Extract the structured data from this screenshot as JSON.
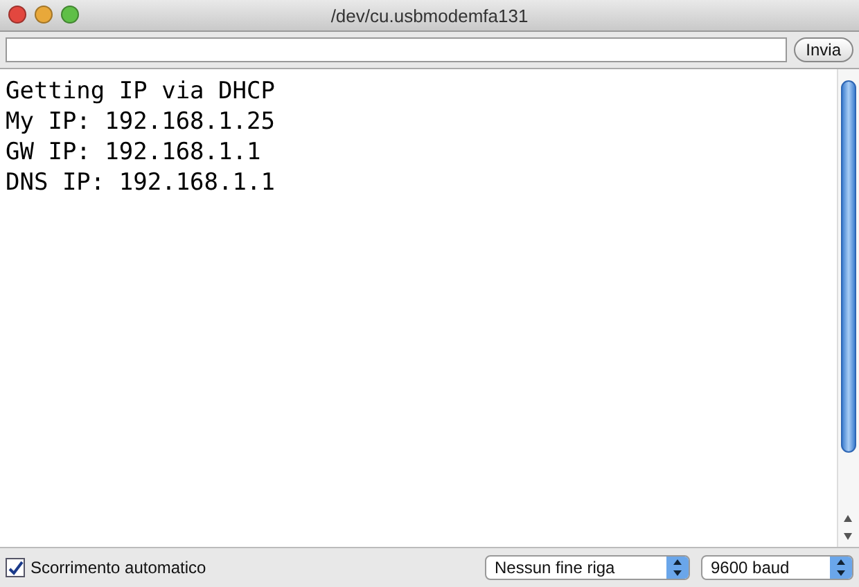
{
  "window": {
    "title": "/dev/cu.usbmodemfa131"
  },
  "send_row": {
    "button": "Invia"
  },
  "output_lines": [
    "Getting IP via DHCP",
    "My IP: 192.168.1.25",
    "GW IP: 192.168.1.1",
    "DNS IP: 192.168.1.1"
  ],
  "bottom_bar": {
    "autoscroll": {
      "label": "Scorrimento automatico",
      "checked": true
    },
    "line_ending": "Nessun fine riga",
    "baud": "9600 baud"
  }
}
